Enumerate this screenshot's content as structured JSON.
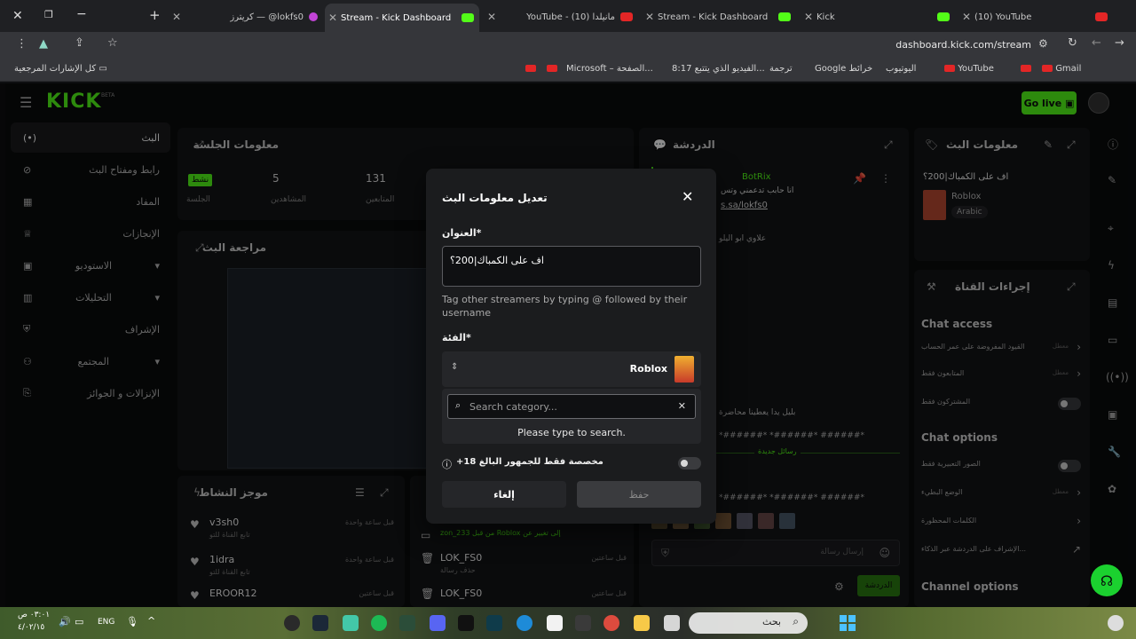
{
  "browser": {
    "tabs": [
      {
        "label": "كريترز — @lokfs0"
      },
      {
        "label": "Stream - Kick Dashboard"
      },
      {
        "label": "YouTube - (10) مانيلدا"
      },
      {
        "label": "Stream - Kick Dashboard"
      },
      {
        "label": "Kick"
      },
      {
        "label": "(10) YouTube"
      }
    ],
    "address": "dashboard.kick.com/stream",
    "bookmarks": [
      "Gmail",
      "YouTube",
      "اليوتيوب",
      "Google خرائط",
      "ترجمة",
      "8:17 الفيديو الذي يتتبع...",
      "الصفحة...",
      "Microsoft –",
      "كل الإشارات المرجعية"
    ]
  },
  "kick": {
    "logo": "KICK",
    "beta": "BETA",
    "go_live": "Go live",
    "sidebar": [
      {
        "label": "البث"
      },
      {
        "label": "رابط ومفتاح البث"
      },
      {
        "label": "المفاد"
      },
      {
        "label": "الإنجازات"
      },
      {
        "label": "الاستوديو"
      },
      {
        "label": "التحليلات"
      },
      {
        "label": "الإشراف"
      },
      {
        "label": "المجتمع"
      },
      {
        "label": "الإنزالات و الجوائز"
      }
    ],
    "session": {
      "title": "معلومات الجلسة",
      "stats": [
        {
          "value": "131",
          "label": "المتابعين"
        },
        {
          "value": "5",
          "label": "المشاهدين"
        },
        {
          "value": "",
          "label": "الجلسة"
        }
      ],
      "badge": "نشط"
    },
    "preview_title": "مراجعة البث",
    "activity": {
      "title": "موجز النشاط",
      "items": [
        {
          "name": "v3sh0",
          "sub": "تابع القناة للتو",
          "time": "قبل ساعة واحدة"
        },
        {
          "name": "1idra",
          "sub": "تابع القناة للتو",
          "time": "قبل ساعة واحدة"
        },
        {
          "name": "EROOR12",
          "sub": "",
          "time": "قبل ساعتين"
        }
      ]
    },
    "feed2": {
      "items": [
        {
          "text": "zon_233 من قبل Roblox إلى تغيير عن",
          "time": ""
        },
        {
          "text": "LOK_FS0",
          "sub": "حذف رسالة",
          "time": "قبل ساعتين"
        },
        {
          "text": "LOK_FS0",
          "sub": "",
          "time": "قبل ساعتين"
        }
      ]
    },
    "chat": {
      "title": "الدردشة",
      "bot": "BotRix",
      "bot_msg": "انا حابب تدعمني وتس",
      "link": "s.sa/lokfs0",
      "lines": [
        "علاوي ابو اليلو",
        "بليل يدا يعطينا محاضرة",
        "*######* *######* ######*",
        "*######* *######* ######*"
      ],
      "new_messages": "رسائل جديدة",
      "send_placeholder": "إرسال رسالة",
      "send_button": "الدردشة"
    },
    "stream_info": {
      "title": "معلومات البث",
      "stream_title": "اف على الكمباك|200؟",
      "category": "Roblox",
      "language": "Arabic"
    },
    "channel_actions": {
      "title": "إجراءات القناة",
      "chat_access": "Chat access",
      "chat_access_items": [
        {
          "label": "القيود المفروضة على عمر الحساب",
          "state": "معطل"
        },
        {
          "label": "المتابعون فقط",
          "state": "معطل"
        },
        {
          "label": "المشتركون فقط",
          "state": ""
        }
      ],
      "chat_options": "Chat options",
      "chat_options_items": [
        {
          "label": "الصور التعبيرية فقط",
          "state": ""
        },
        {
          "label": "الوضع البطيء",
          "state": "معطل"
        },
        {
          "label": "الكلمات المحظورة",
          "state": ""
        },
        {
          "label": "الإشراف على الدردشة عبر الذكاء...",
          "state": ""
        }
      ],
      "channel_options": "Channel options"
    }
  },
  "modal": {
    "title": "تعديل معلومات البث",
    "title_label": "العنوان*",
    "title_value": "اف على الكمباك|200؟",
    "tag_hint": "Tag other streamers by typing @ followed by their username",
    "category_label": "الفئة*",
    "category_value": "Roblox",
    "search_placeholder": "Search category...",
    "search_hint": "Please type to search.",
    "mature_label": "مخصصة فقط للجمهور البالغ 18+",
    "cancel": "إلغاء",
    "save": "حفظ"
  },
  "taskbar": {
    "search": "بحث",
    "lang": "ENG",
    "time": "٠٣:٠١ ص",
    "date": "٤/٠٢/١٥"
  }
}
